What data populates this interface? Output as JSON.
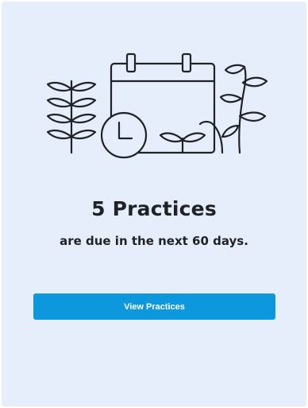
{
  "card": {
    "headline": "5 Practices",
    "subtext": "are due in the next 60 days.",
    "button_label": "View Practices"
  },
  "colors": {
    "card_background": "#e6eefb",
    "button": "#0d97dc",
    "text": "#1f2328",
    "illustration_stroke": "#1f2328"
  },
  "icons": [
    "calendar-icon",
    "clock-icon",
    "plant-icon"
  ]
}
